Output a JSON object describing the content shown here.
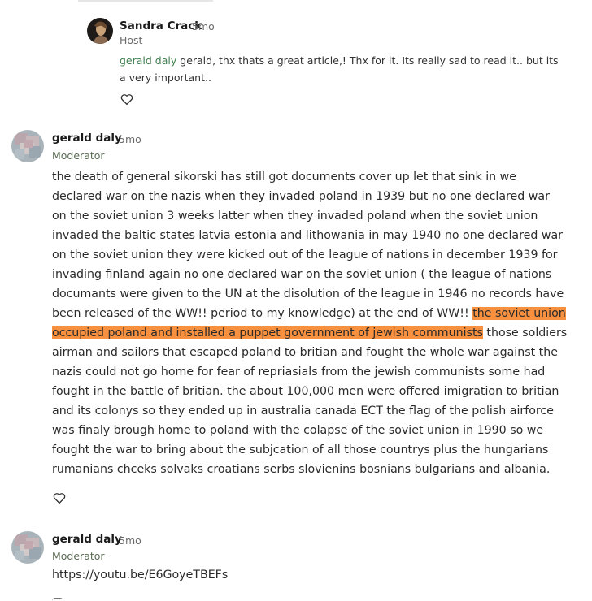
{
  "reply": {
    "author": "Sandra Crack",
    "time": "5mo",
    "role": "Host",
    "mention": "gerald daly",
    "text": " gerald, thx thats a great article,! Thx for it. Its really sad to read it.. but its a very important.."
  },
  "comment1": {
    "author": "gerald daly",
    "time": "5mo",
    "role": "Moderator",
    "text_before": "the death of general sikorski has still got documents cover up let that sink in we declared war on the nazis when they invaded poland in 1939 but no one declared war on the soviet union 3 weeks latter when they invaded poland when the soviet union invaded the baltic states latvia estonia and lithowania in may 1940 no one declared war on the soviet union they were kicked out of the league of nations in december 1939 for invading finland again no one declared war on the soviet union ( the league of nations documants were given to the UN at the disolution of the league in 1946 no records have been released of the WW!! period to my knowledge) at the end of WW!! ",
    "text_highlight": "the soviet union occupied poland and installed a puppet government of jewish communists",
    "text_after": " those soldiers airman and sailors that escaped poland to britian and fought the whole war against the nazis could not go home for fear of repriasials from the jewish communists some had fought in the battle of britian. the about 100,000 men were offered imigration to britian and its colonys so they ended up in australia canada ECT the flag of the polish airforce was finaly brough home to poland with the colapse of the soviet union in 1990 so we fought the war to bring about the subjcation of all those countrys plus the hungarians rumanians chceks solvaks croatians serbs slovienins bosnians bulgarians and albania."
  },
  "comment2": {
    "author": "gerald daly",
    "time": "5mo",
    "role": "Moderator",
    "link": "https://youtu.be/E6GoyeTBEFs"
  },
  "colors": {
    "highlight": "#f7903f",
    "mention": "#3f7d4e",
    "role": "#5a6b52"
  },
  "icons": [
    "heart-icon",
    "avatar-photo",
    "avatar-pixelated"
  ]
}
